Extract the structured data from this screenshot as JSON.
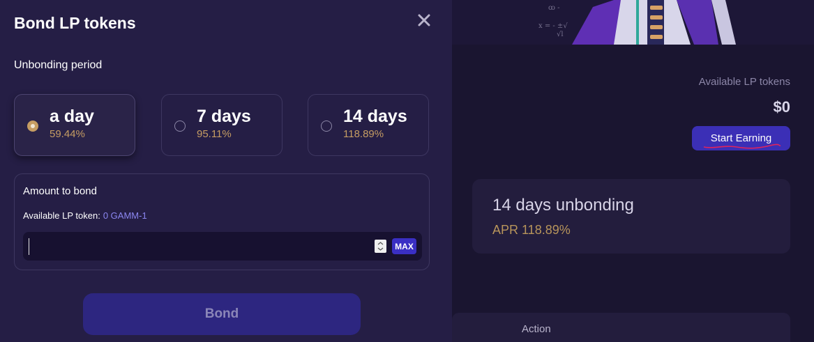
{
  "modal": {
    "title": "Bond LP tokens",
    "unbonding_label": "Unbonding period",
    "periods": [
      {
        "label": "a day",
        "apr": "59.44%",
        "selected": true
      },
      {
        "label": "7 days",
        "apr": "95.11%",
        "selected": false
      },
      {
        "label": "14 days",
        "apr": "118.89%",
        "selected": false
      }
    ],
    "amount": {
      "title": "Amount to bond",
      "available_label": "Available LP token:",
      "available_value": "0 GAMM-1",
      "input_value": "",
      "max_label": "MAX"
    },
    "bond_label": "Bond"
  },
  "background": {
    "available_label": "Available LP tokens",
    "available_value": "$0",
    "start_earning_label": "Start Earning",
    "unbond_card": {
      "title": "14 days unbonding",
      "apr": "APR 118.89%"
    },
    "table_header_action": "Action"
  },
  "colors": {
    "accent": "#3b2fb6",
    "gold": "#c69d63",
    "modal_bg": "#251e45"
  },
  "icons": [
    "close-icon",
    "radio-icon",
    "stepper-icon"
  ]
}
